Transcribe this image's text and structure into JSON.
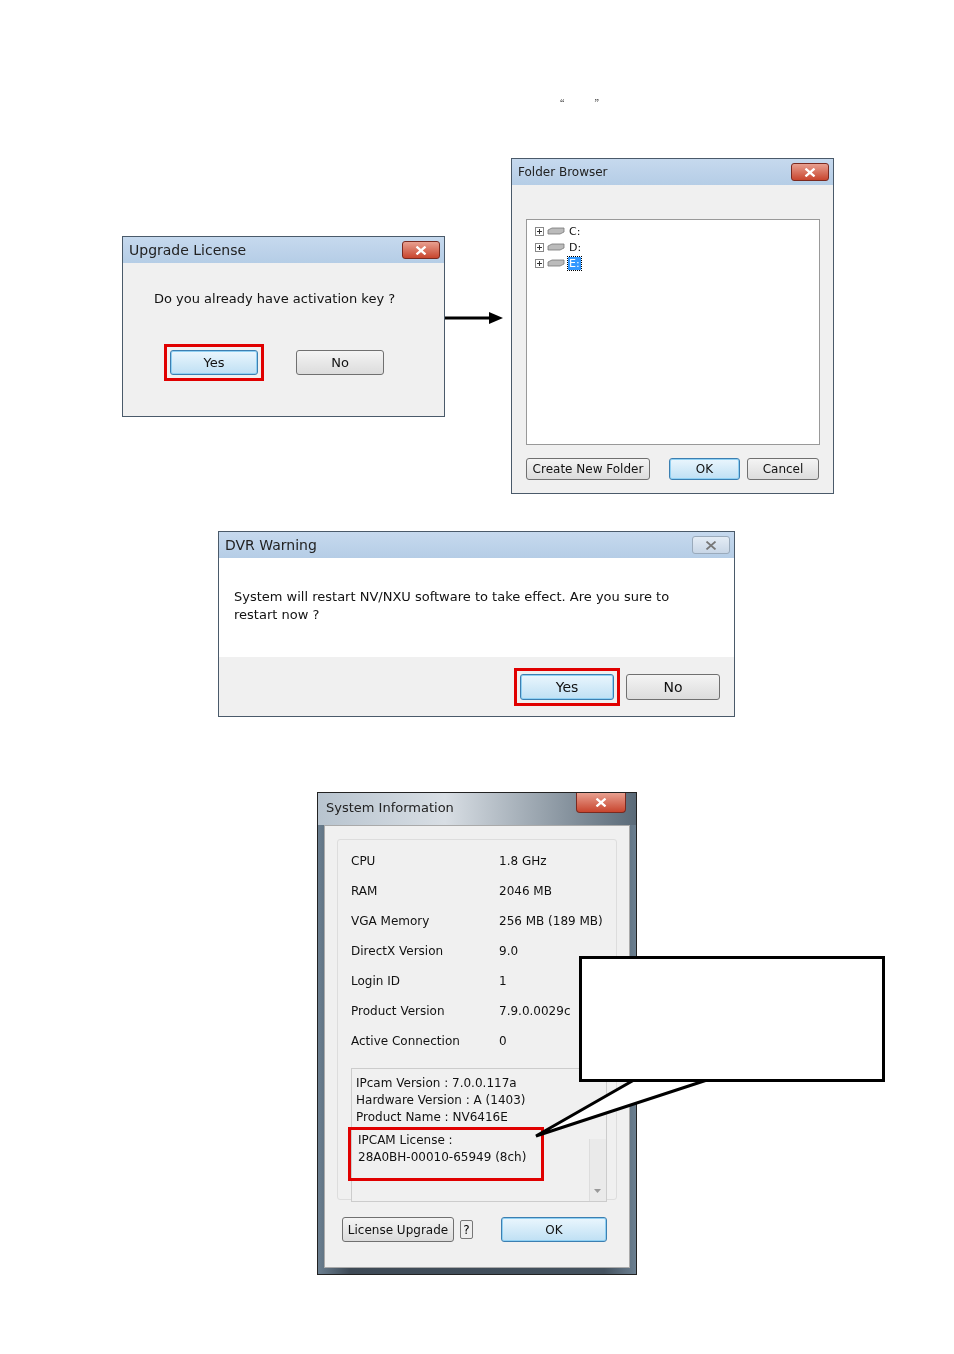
{
  "quote_marks": [
    "“",
    "”"
  ],
  "upgrade_dialog": {
    "title": "Upgrade License",
    "message": "Do you already have activation key ?",
    "buttons": [
      {
        "label": "Yes",
        "default": true,
        "highlighted": true
      },
      {
        "label": "No",
        "default": false,
        "highlighted": false
      }
    ]
  },
  "folder_browser": {
    "title": "Folder Browser",
    "drives": [
      {
        "label": "C:",
        "selected": false
      },
      {
        "label": "D:",
        "selected": false
      },
      {
        "label": "E:",
        "selected": true
      }
    ],
    "buttons": [
      {
        "label": "Create New Folder",
        "default": false
      },
      {
        "label": "OK",
        "default": true
      },
      {
        "label": "Cancel",
        "default": false
      }
    ]
  },
  "dvr_warning": {
    "title": "DVR Warning",
    "message": "System will restart NV/NXU software to take effect. Are you sure to restart now ?",
    "buttons": [
      {
        "label": "Yes",
        "default": true,
        "highlighted": true
      },
      {
        "label": "No",
        "default": false,
        "highlighted": false
      }
    ]
  },
  "system_info": {
    "title": "System Information",
    "rows": [
      {
        "label": "CPU",
        "value": "1.8 GHz"
      },
      {
        "label": "RAM",
        "value": "2046 MB"
      },
      {
        "label": "VGA Memory",
        "value": "256 MB (189 MB)"
      },
      {
        "label": "DirectX Version",
        "value": "9.0"
      },
      {
        "label": "Login ID",
        "value": "1"
      },
      {
        "label": "Product Version",
        "value": "7.9.0.0029c"
      },
      {
        "label": "Active Connection",
        "value": "0"
      }
    ],
    "details": [
      "IPcam Version : 7.0.0.117a",
      "Hardware Version : A (1403)",
      "Product Name : NV6416E"
    ],
    "license": {
      "lines": [
        "IPCAM License :",
        "28A0BH-00010-65949 (8ch)"
      ],
      "highlighted": true
    },
    "buttons": [
      {
        "label": "License Upgrade",
        "kind": "plain",
        "default": false
      },
      {
        "label": "?",
        "kind": "help",
        "default": false
      },
      {
        "label": "OK",
        "kind": "plain",
        "default": true
      }
    ]
  }
}
